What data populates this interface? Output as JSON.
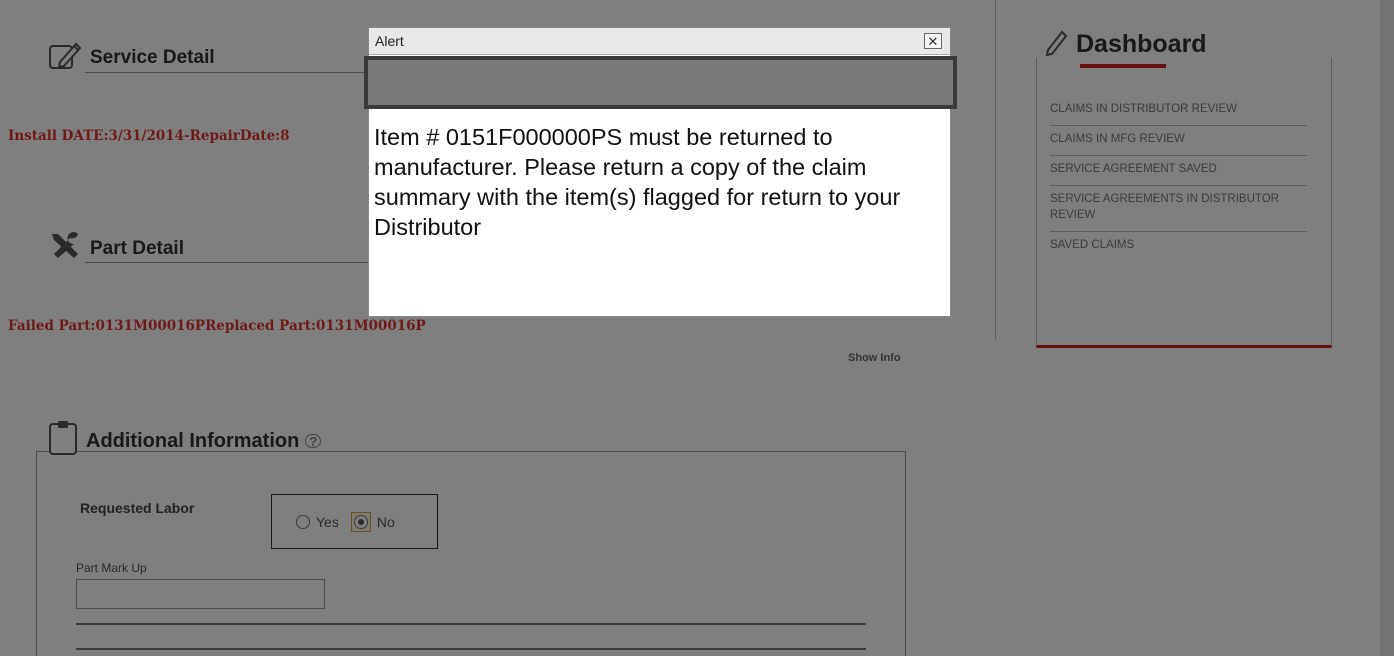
{
  "service_detail": {
    "title": "Service Detail",
    "info_text": "Install DATE:3/31/2014-RepairDate:8"
  },
  "part_detail": {
    "title": "Part Detail",
    "info_text": "Failed Part:0131M00016PReplaced Part:0131M00016P",
    "show_info_label": "Show Info"
  },
  "additional_info": {
    "title": "Additional Information",
    "requested_labor_label": "Requested Labor",
    "radio_yes": "Yes",
    "radio_no": "No",
    "selected": "No",
    "part_markup_label": "Part Mark Up",
    "part_markup_value": ""
  },
  "dashboard": {
    "title": "Dashboard",
    "items": [
      "CLAIMS IN DISTRIBUTOR REVIEW",
      "CLAIMS IN MFG REVIEW",
      "SERVICE AGREEMENT SAVED",
      "SERVICE AGREEMENTS IN DISTRIBUTOR REVIEW",
      "SAVED CLAIMS"
    ]
  },
  "alert": {
    "title": "Alert",
    "close_glyph": "✕",
    "message": "Item # 0151F000000PS  must be returned to manufacturer. Please return a copy of the claim summary with the item(s) flagged for return to your Distributor"
  },
  "colors": {
    "accent_red": "#cc2222",
    "info_red": "#e03030",
    "overlay": "rgba(0,0,0,0.5)"
  },
  "icons": {
    "service_detail": "edit-document-icon",
    "part_detail": "wrench-screwdriver-icon",
    "additional_info": "clipboard-icon",
    "help": "help-bubble-icon",
    "dashboard": "pencil-icon",
    "alert_close": "close-icon"
  }
}
